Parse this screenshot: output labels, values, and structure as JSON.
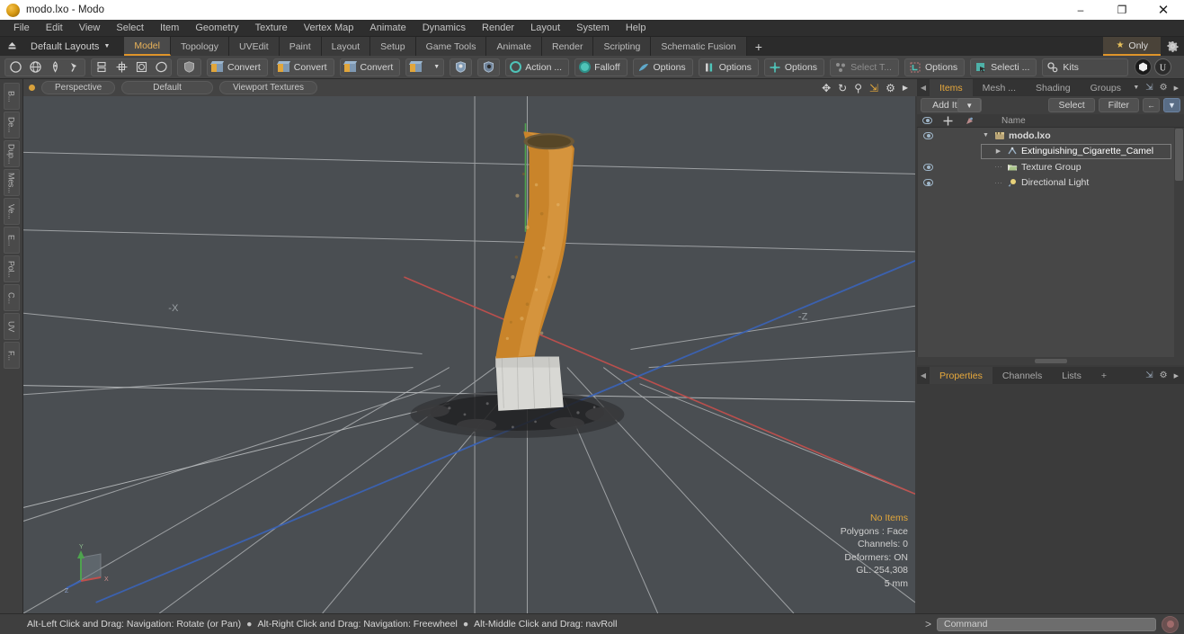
{
  "window": {
    "title": "modo.lxo - Modo",
    "logo_icon": "modo-orb-icon",
    "minimize_icon": "minimize-icon",
    "restore_icon": "restore-icon",
    "close_icon": "close-icon"
  },
  "menubar": {
    "items": [
      "File",
      "Edit",
      "View",
      "Select",
      "Item",
      "Geometry",
      "Texture",
      "Vertex Map",
      "Animate",
      "Dynamics",
      "Render",
      "Layout",
      "System",
      "Help"
    ]
  },
  "layoutbar": {
    "home_icon": "home-up-icon",
    "layouts_label": "Default Layouts",
    "tabs": [
      {
        "label": "Model",
        "active": true
      },
      {
        "label": "Topology",
        "active": false
      },
      {
        "label": "UVEdit",
        "active": false
      },
      {
        "label": "Paint",
        "active": false
      },
      {
        "label": "Layout",
        "active": false
      },
      {
        "label": "Setup",
        "active": false
      },
      {
        "label": "Game Tools",
        "active": false
      },
      {
        "label": "Animate",
        "active": false
      },
      {
        "label": "Render",
        "active": false
      },
      {
        "label": "Scripting",
        "active": false
      },
      {
        "label": "Schematic Fusion",
        "active": false
      }
    ],
    "add_tab_label": "+",
    "only_label": "Only",
    "only_star_icon": "star-icon",
    "gear_icon": "gear-icon"
  },
  "toolbar": {
    "primitive_icons": [
      "circle-icon",
      "globe-icon",
      "pen-icon",
      "paint-icon"
    ],
    "mesh_icons": [
      "mirror-icon",
      "array-icon",
      "bevel-icon",
      "smooth-icon"
    ],
    "shield_icon": "shield-icon",
    "convert_buttons": [
      {
        "label": "Convert",
        "icon": "cube-icon"
      },
      {
        "label": "Convert",
        "icon": "cube-icon"
      },
      {
        "label": "Convert",
        "icon": "cube-icon"
      }
    ],
    "cube_dropdown_icon": "cube-dropdown-icon",
    "falloff_shield_icons": [
      "shield-falloff-icon",
      "shield-mask-icon"
    ],
    "action_label": "Action  ...",
    "action_icon": "action-center-icon",
    "falloff_label": "Falloff",
    "falloff_icon": "falloff-icon",
    "options_1_label": "Options",
    "options_1_icon": "tool-options-icon",
    "options_2_label": "Options",
    "options_2_icon": "bar-options-icon",
    "options_3_label": "Options",
    "options_3_icon": "cross-options-icon",
    "select_through_label": "Select T...",
    "select_through_icon": "select-through-icon",
    "options_4_label": "Options",
    "options_4_icon": "grid-options-icon",
    "selection_label": "Selecti ...",
    "selection_icon": "selection-icon",
    "kits_label": "Kits",
    "kits_icon": "kits-gear-icon",
    "end_icons": [
      "sphere-badge-icon",
      "unreal-badge-icon"
    ]
  },
  "rail": {
    "tabs": [
      "B...",
      "De...",
      "Dup...",
      "Mes...",
      "Ve...",
      "E...",
      "Pol...",
      "C...",
      "UV",
      "F..."
    ]
  },
  "viewport": {
    "bullet_icon": "viewport-dot-icon",
    "perspective_label": "Perspective",
    "default_label": "Default",
    "textures_label": "Viewport Textures",
    "control_icons": [
      "pan-icon",
      "rotate-icon",
      "zoom-icon",
      "fit-icon",
      "viewport-gear-icon",
      "viewport-arrow-icon"
    ],
    "stats": {
      "items": "No Items",
      "polygons": "Polygons : Face",
      "channels": "Channels: 0",
      "deformers": "Deformers: ON",
      "gl": "GL: 254,308",
      "scale": "5 mm"
    },
    "gizmo": {
      "x_label": "X",
      "y_label": "Y",
      "z_label": "Z"
    },
    "axis_labels": {
      "neg_x": "-X",
      "neg_z": "-Z"
    },
    "colors": {
      "background": "#4a4e52",
      "x_axis": "#c0504d",
      "y_axis": "#4ea34e",
      "z_axis": "#3b63b5",
      "grid": "#b9bcbe",
      "filter": "#c9842a",
      "paper": "#d8d8d4",
      "ash": "#2a2a2c"
    }
  },
  "items_panel": {
    "tabs": [
      {
        "label": "Items",
        "active": true
      },
      {
        "label": "Mesh ...",
        "active": false
      },
      {
        "label": "Shading",
        "active": false
      },
      {
        "label": "Groups",
        "active": false
      }
    ],
    "dropdown_icon": "chevron-down-icon",
    "expand_icon": "expand-icon",
    "gear_icon": "gear-icon",
    "arrow_icon": "chevron-right-icon",
    "add_item_label": "Add Item",
    "add_item_dropdown_icon": "chevron-down-icon",
    "select_label": "Select",
    "filter_label": "Filter",
    "back_icon": "arrow-left-icon",
    "funnel_icon": "funnel-icon",
    "columns": {
      "eye_icon": "eye-icon",
      "lock_icon": "crosshair-icon",
      "render_icon": "render-flag-icon",
      "name": "Name"
    },
    "rows": [
      {
        "name": "modo.lxo",
        "icon": "scene-icon",
        "indent": 0,
        "twisty": "down",
        "eye": true,
        "root": true,
        "selected": false
      },
      {
        "name": "Extinguishing_Cigarette_Camel",
        "icon": "mesh-icon",
        "indent": 1,
        "twisty": "right",
        "eye": false,
        "root": false,
        "selected": true
      },
      {
        "name": "Texture Group",
        "icon": "folder-icon",
        "indent": 1,
        "twisty": "none",
        "eye": true,
        "root": false,
        "selected": false
      },
      {
        "name": "Directional Light",
        "icon": "light-icon",
        "indent": 1,
        "twisty": "none",
        "eye": true,
        "root": false,
        "selected": false
      }
    ]
  },
  "properties_panel": {
    "tabs": [
      {
        "label": "Properties",
        "active": true
      },
      {
        "label": "Channels",
        "active": false
      },
      {
        "label": "Lists",
        "active": false
      },
      {
        "label": "+",
        "active": false
      }
    ],
    "expand_icon": "expand-icon",
    "gear_icon": "gear-icon",
    "arrow_icon": "chevron-right-icon"
  },
  "statusbar": {
    "hints": [
      "Alt-Left Click and Drag: Navigation: Rotate (or Pan)",
      "Alt-Right Click and Drag: Navigation: Freewheel",
      "Alt-Middle Click and Drag: navRoll"
    ],
    "separator": "●",
    "command_prompt": ">",
    "command_placeholder": "Command",
    "record_icon": "record-icon"
  }
}
